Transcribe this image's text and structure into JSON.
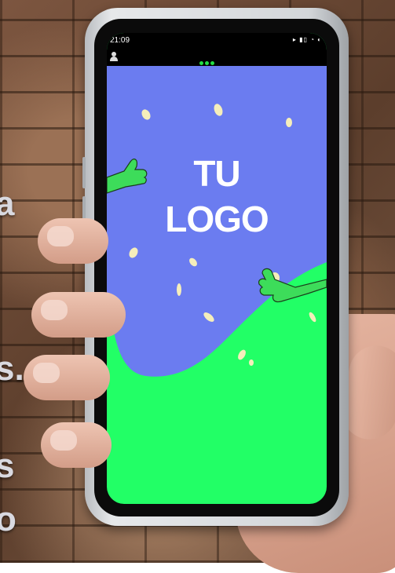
{
  "status_bar": {
    "time": "21:09",
    "icons": "▸ ▮▯ ◔ ◐"
  },
  "screen": {
    "logo_line1": "TU",
    "logo_line2": "LOGO"
  },
  "side_text": [
    "a",
    "s.",
    "s",
    "o"
  ],
  "colors": {
    "blue_bg": "#6b7cf0",
    "green_bg": "#22ff66",
    "thumbs": "#3ddc5a",
    "flakes": "#f5eebb"
  }
}
